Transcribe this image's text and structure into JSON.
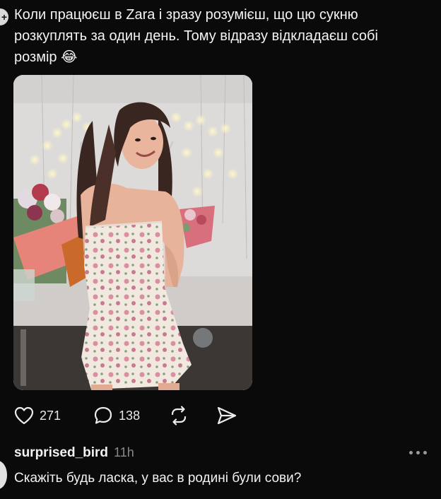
{
  "post": {
    "text": "Коли працюєш в Zara і зразу розумієш, що цю сукню розкуплять за один день. Тому відразу відкладаєш собі розмір 😂"
  },
  "actions": {
    "likes": "271",
    "comments": "138"
  },
  "comment": {
    "username": "surprised_bird",
    "time": "11h",
    "text": "Скажіть будь ласка, у вас в родині були сови?"
  },
  "colors": {
    "background": "#0a0a0a",
    "text": "#f2f2f2",
    "muted": "#8a8a8a"
  }
}
